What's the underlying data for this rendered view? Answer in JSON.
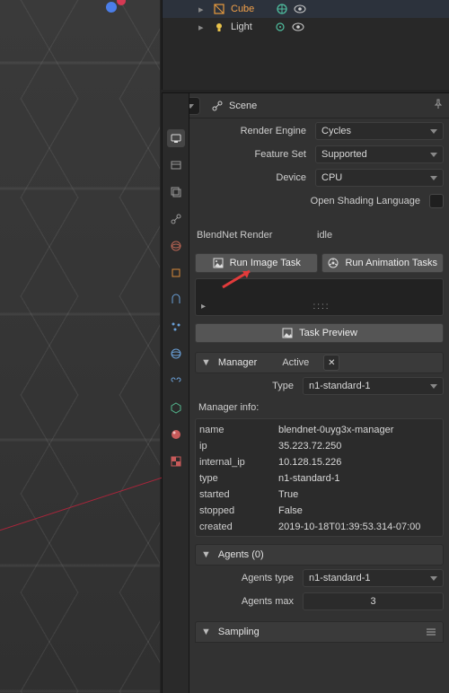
{
  "outliner": {
    "items": [
      {
        "name": "Cube",
        "active": true,
        "icon": "mesh"
      },
      {
        "name": "Light",
        "active": false,
        "icon": "light"
      }
    ]
  },
  "context": {
    "scene_label": "Scene"
  },
  "render": {
    "engine_label": "Render Engine",
    "engine_value": "Cycles",
    "feature_label": "Feature Set",
    "feature_value": "Supported",
    "device_label": "Device",
    "device_value": "CPU",
    "osl_label": "Open Shading Language",
    "osl_checked": false
  },
  "blendnet": {
    "title_label": "BlendNet Render",
    "status": "idle",
    "run_image_label": "Run Image Task",
    "run_anim_label": "Run Animation Tasks",
    "task_preview_label": "Task Preview",
    "preview_placeholder": "::::"
  },
  "manager": {
    "header": "Manager",
    "status": "Active",
    "type_label": "Type",
    "type_value": "n1-standard-1",
    "info_label": "Manager info:",
    "rows": {
      "name": "blendnet-0uyg3x-manager",
      "ip": "35.223.72.250",
      "internal_ip": "10.128.15.226",
      "type": "n1-standard-1",
      "started": "True",
      "stopped": "False",
      "created": "2019-10-18T01:39:53.314-07:00"
    },
    "row_labels": {
      "name": "name",
      "ip": "ip",
      "internal_ip": "internal_ip",
      "type": "type",
      "started": "started",
      "stopped": "stopped",
      "created": "created"
    }
  },
  "agents": {
    "header": "Agents (0)",
    "type_label": "Agents type",
    "type_value": "n1-standard-1",
    "max_label": "Agents max",
    "max_value": "3"
  },
  "sampling": {
    "header": "Sampling"
  }
}
